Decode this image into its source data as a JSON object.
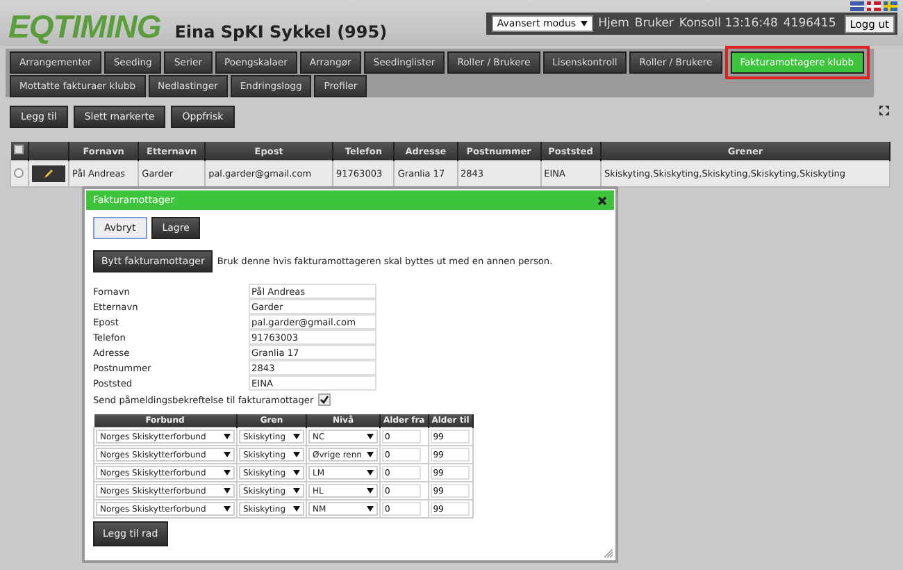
{
  "header": {
    "logo": "EQTIMING",
    "title": "Eina SpKI Sykkel (995)",
    "mode_select": "Avansert modus",
    "links": [
      "Hjem",
      "Bruker",
      "Konsoll 13:16:48",
      "4196415"
    ],
    "logout": "Logg ut"
  },
  "tabs": [
    {
      "label": "Arrangementer",
      "selected": false
    },
    {
      "label": "Seeding",
      "selected": false
    },
    {
      "label": "Serier",
      "selected": false
    },
    {
      "label": "Poengskalaer",
      "selected": false
    },
    {
      "label": "Arrangør",
      "selected": false
    },
    {
      "label": "Seedinglister",
      "selected": false
    },
    {
      "label": "Roller / Brukere",
      "selected": false
    },
    {
      "label": "Lisenskontroll",
      "selected": false
    },
    {
      "label": "Roller / Brukere",
      "selected": false
    },
    {
      "label": "Fakturamottagere klubb",
      "selected": true
    },
    {
      "label": "Mottatte fakturaer klubb",
      "selected": false
    },
    {
      "label": "Nedlastinger",
      "selected": false
    },
    {
      "label": "Endringslogg",
      "selected": false
    },
    {
      "label": "Profiler",
      "selected": false
    }
  ],
  "toolbar": [
    "Legg til",
    "Slett markerte",
    "Oppfrisk"
  ],
  "table": {
    "select_all_checked": false,
    "columns": [
      "Fornavn",
      "Etternavn",
      "Epost",
      "Telefon",
      "Adresse",
      "Postnummer",
      "Poststed",
      "Grener"
    ],
    "rows": [
      {
        "checked": false,
        "cells": [
          "Pål Andreas",
          "Garder",
          "pal.garder@gmail.com",
          "91763003",
          "Granlia 17",
          "2843",
          "EINA",
          "Skiskyting,Skiskyting,Skiskyting,Skiskyting,Skiskyting"
        ]
      }
    ]
  },
  "dialog": {
    "title": "Fakturamottager",
    "buttons": [
      "Avbryt",
      "Lagre"
    ],
    "swap_button": "Bytt fakturamottager",
    "swap_hint": "Bruk denne hvis fakturamottageren skal byttes ut med en annen person.",
    "fields": [
      {
        "label": "Fornavn",
        "value": "Pål Andreas"
      },
      {
        "label": "Etternavn",
        "value": "Garder"
      },
      {
        "label": "Epost",
        "value": "pal.garder@gmail.com"
      },
      {
        "label": "Telefon",
        "value": "91763003"
      },
      {
        "label": "Adresse",
        "value": "Granlia 17"
      },
      {
        "label": "Postnummer",
        "value": "2843"
      },
      {
        "label": "Poststed",
        "value": "EINA"
      }
    ],
    "confirm": {
      "label": "Send påmeldingsbekreftelse til fakturamottager",
      "checked": true
    },
    "grid": {
      "columns": [
        "Forbund",
        "Gren",
        "Nivå",
        "Alder fra",
        "Alder til"
      ],
      "rows": [
        [
          "Norges Skiskytterforbund",
          "Skiskyting",
          "NC",
          "0",
          "99"
        ],
        [
          "Norges Skiskytterforbund",
          "Skiskyting",
          "Øvrige renn",
          "0",
          "99"
        ],
        [
          "Norges Skiskytterforbund",
          "Skiskyting",
          "LM",
          "0",
          "99"
        ],
        [
          "Norges Skiskytterforbund",
          "Skiskyting",
          "HL",
          "0",
          "99"
        ],
        [
          "Norges Skiskytterforbund",
          "Skiskyting",
          "NM",
          "0",
          "99"
        ]
      ]
    },
    "add_row": "Legg til rad"
  }
}
